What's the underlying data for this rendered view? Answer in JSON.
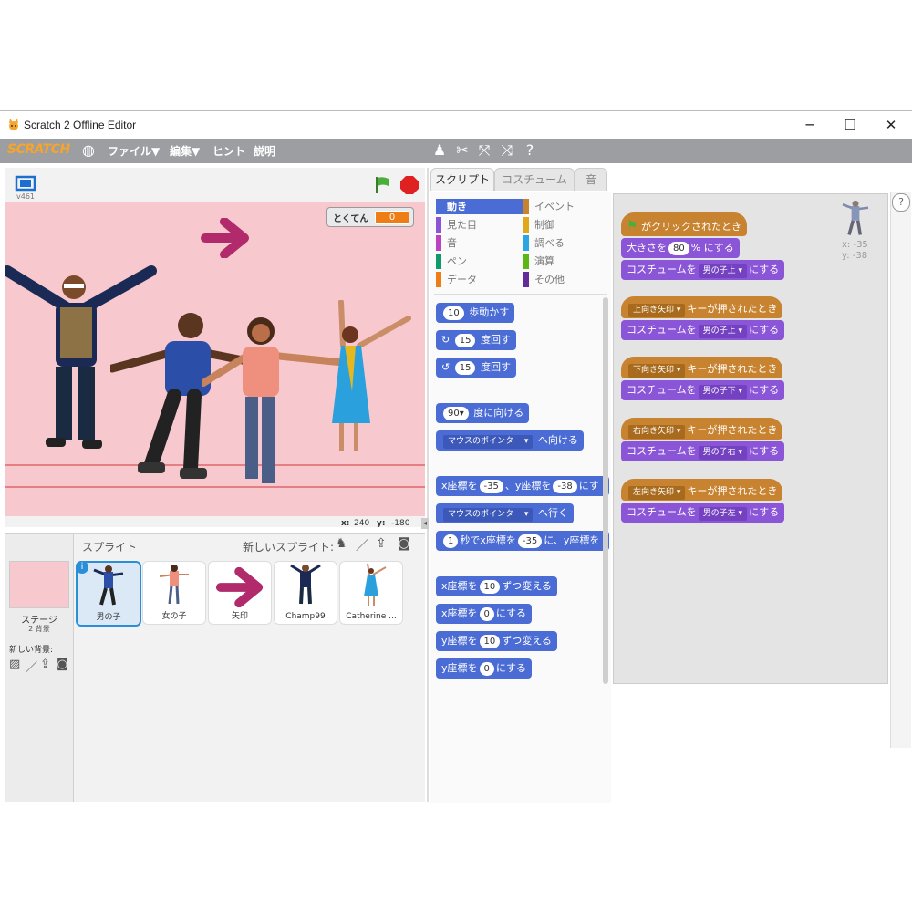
{
  "window": {
    "title": "Scratch 2 Offline Editor",
    "minimize": "─",
    "maximize": "☐",
    "close": "✕"
  },
  "menubar": {
    "logo": "SCRATCH",
    "file": "ファイル▼",
    "edit": "編集▼",
    "tips": "ヒント",
    "about": "説明"
  },
  "stage": {
    "version": "v461",
    "score_label": "とくてん",
    "score_value": "0",
    "coord_x_label": "x:",
    "coord_x": "240",
    "coord_y_label": "y:",
    "coord_y": "-180"
  },
  "sprites": {
    "header": "スプライト",
    "new_sprite": "新しいスプライト:",
    "stage_label": "ステージ",
    "stage_backdrops": "2 背景",
    "new_backdrop": "新しい背景:",
    "items": [
      {
        "label": "男の子"
      },
      {
        "label": "女の子"
      },
      {
        "label": "矢印"
      },
      {
        "label": "Champ99"
      },
      {
        "label": "Catherine ..."
      }
    ]
  },
  "tabs": {
    "scripts": "スクリプト",
    "costumes": "コスチューム",
    "sounds": "音"
  },
  "categories": {
    "motion": "動き",
    "looks": "見た目",
    "sound": "音",
    "pen": "ペン",
    "data": "データ",
    "events": "イベント",
    "control": "制御",
    "sensing": "調べる",
    "operators": "演算",
    "more": "その他"
  },
  "palette": {
    "move_num": "10",
    "move_text": "歩動かす",
    "turn_r_num": "15",
    "turn_r_text": "度回す",
    "turn_l_num": "15",
    "turn_l_text": "度回す",
    "point_dir_num": "90▾",
    "point_dir_text": "度に向ける",
    "point_toward_drop": "マウスのポインター ▾",
    "point_toward_text": "へ向ける",
    "goto_xy_a": "x座標を",
    "goto_xy_x": "-35",
    "goto_xy_b": "、y座標を",
    "goto_xy_y": "-38",
    "goto_xy_c": "にす",
    "goto_drop": "マウスのポインター ▾",
    "goto_text": "へ行く",
    "glide_num": "1",
    "glide_a": "秒でx座標を",
    "glide_x": "-35",
    "glide_b": "に、y座標を",
    "change_x_a": "x座標を",
    "change_x_num": "10",
    "change_x_b": "ずつ変える",
    "set_x_a": "x座標を",
    "set_x_num": "0",
    "set_x_b": "にする",
    "change_y_a": "y座標を",
    "change_y_num": "10",
    "change_y_b": "ずつ変える",
    "set_y_a": "y座標を",
    "set_y_num": "0",
    "set_y_b": "にする"
  },
  "scripts": {
    "sprite_x": "x: -35",
    "sprite_y": "y: -38",
    "flag_hat": "がクリックされたとき",
    "size_a": "大きさを",
    "size_num": "80",
    "size_b": "% にする",
    "costume_a": "コスチュームを",
    "costume_up": "男の子上 ▾",
    "costume_down": "男の子下 ▾",
    "costume_right": "男の子右 ▾",
    "costume_left": "男の子左 ▾",
    "costume_b": "にする",
    "key_up": "上向き矢印 ▾",
    "key_down": "下向き矢印 ▾",
    "key_right": "右向き矢印 ▾",
    "key_left": "左向き矢印 ▾",
    "key_pressed": "キーが押されたとき"
  },
  "colors": {
    "menubar": "#9c9ea2",
    "stage_bg": "#f7c8cd",
    "motion": "#4a6cd4",
    "looks": "#8a55d7",
    "events": "#c88330"
  }
}
